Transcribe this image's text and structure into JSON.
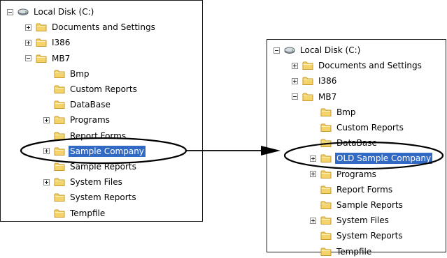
{
  "left_tree": {
    "root": "Local Disk (C:)",
    "items": [
      {
        "label": "Documents and Settings",
        "level": 1,
        "toggle": "plus"
      },
      {
        "label": "I386",
        "level": 1,
        "toggle": "plus"
      },
      {
        "label": "MB7",
        "level": 1,
        "toggle": "minus"
      },
      {
        "label": "Bmp",
        "level": 2,
        "toggle": "none"
      },
      {
        "label": "Custom Reports",
        "level": 2,
        "toggle": "none"
      },
      {
        "label": "DataBase",
        "level": 2,
        "toggle": "none"
      },
      {
        "label": "Programs",
        "level": 2,
        "toggle": "plus"
      },
      {
        "label": "Report Forms",
        "level": 2,
        "toggle": "none"
      },
      {
        "label": "Sample Company",
        "level": 2,
        "toggle": "plus",
        "selected": true
      },
      {
        "label": "Sample Reports",
        "level": 2,
        "toggle": "none"
      },
      {
        "label": "System Files",
        "level": 2,
        "toggle": "plus"
      },
      {
        "label": "System Reports",
        "level": 2,
        "toggle": "none"
      },
      {
        "label": "Tempfile",
        "level": 2,
        "toggle": "none"
      }
    ]
  },
  "right_tree": {
    "root": "Local Disk (C:)",
    "items": [
      {
        "label": "Documents and Settings",
        "level": 1,
        "toggle": "plus"
      },
      {
        "label": "I386",
        "level": 1,
        "toggle": "plus"
      },
      {
        "label": "MB7",
        "level": 1,
        "toggle": "minus"
      },
      {
        "label": "Bmp",
        "level": 2,
        "toggle": "none"
      },
      {
        "label": "Custom Reports",
        "level": 2,
        "toggle": "none"
      },
      {
        "label": "DataBase",
        "level": 2,
        "toggle": "none"
      },
      {
        "label": "OLD Sample Company",
        "level": 2,
        "toggle": "plus",
        "selected": true
      },
      {
        "label": "Programs",
        "level": 2,
        "toggle": "plus"
      },
      {
        "label": "Report Forms",
        "level": 2,
        "toggle": "none"
      },
      {
        "label": "Sample Reports",
        "level": 2,
        "toggle": "none"
      },
      {
        "label": "System Files",
        "level": 2,
        "toggle": "plus"
      },
      {
        "label": "System Reports",
        "level": 2,
        "toggle": "none"
      },
      {
        "label": "Tempfile",
        "level": 2,
        "toggle": "none"
      }
    ]
  },
  "colors": {
    "selection": "#316ac5",
    "folder": "#f5d36b",
    "folder_edge": "#c79a2a",
    "disk": "#9aa3ad"
  },
  "icons": {
    "root": "hard-disk-icon",
    "item": "folder-icon"
  }
}
